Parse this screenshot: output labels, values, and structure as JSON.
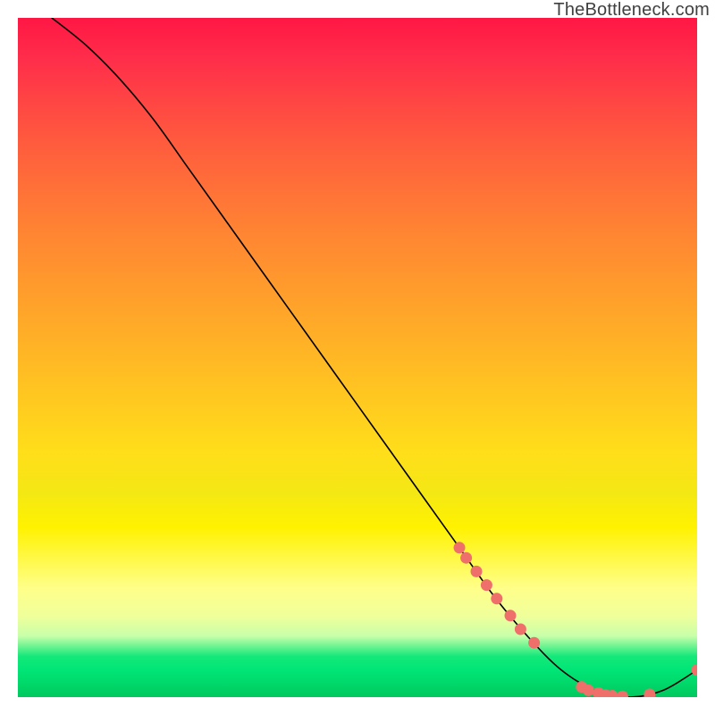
{
  "watermark": "TheBottleneck.com",
  "chart_data": {
    "type": "line",
    "title": "",
    "xlabel": "",
    "ylabel": "",
    "xlim": [
      0,
      100
    ],
    "ylim": [
      0,
      100
    ],
    "grid": false,
    "legend": false,
    "series": [
      {
        "name": "bottleneck-curve",
        "stroke": "#000000",
        "x": [
          5,
          10,
          15,
          20,
          25,
          30,
          35,
          40,
          45,
          50,
          55,
          60,
          65,
          70,
          75,
          80,
          85,
          90,
          95,
          100
        ],
        "y": [
          100,
          96,
          91,
          85,
          78,
          71,
          64,
          57,
          50,
          43,
          36,
          29,
          22,
          15,
          9,
          4,
          1,
          0,
          1,
          4
        ]
      }
    ],
    "markers": [
      {
        "name": "highlighted-points",
        "color": "#ef6f6a",
        "points": [
          {
            "x": 65,
            "y": 22
          },
          {
            "x": 66,
            "y": 20.5
          },
          {
            "x": 67.5,
            "y": 18.5
          },
          {
            "x": 69,
            "y": 16.5
          },
          {
            "x": 70.5,
            "y": 14.5
          },
          {
            "x": 72.5,
            "y": 12
          },
          {
            "x": 74,
            "y": 10
          },
          {
            "x": 76,
            "y": 8
          },
          {
            "x": 83,
            "y": 1.5
          },
          {
            "x": 84,
            "y": 1
          },
          {
            "x": 85.5,
            "y": 0.6
          },
          {
            "x": 86.5,
            "y": 0.3
          },
          {
            "x": 87.5,
            "y": 0.2
          },
          {
            "x": 89,
            "y": 0.1
          },
          {
            "x": 93,
            "y": 0.4
          },
          {
            "x": 100,
            "y": 4
          }
        ]
      }
    ]
  }
}
